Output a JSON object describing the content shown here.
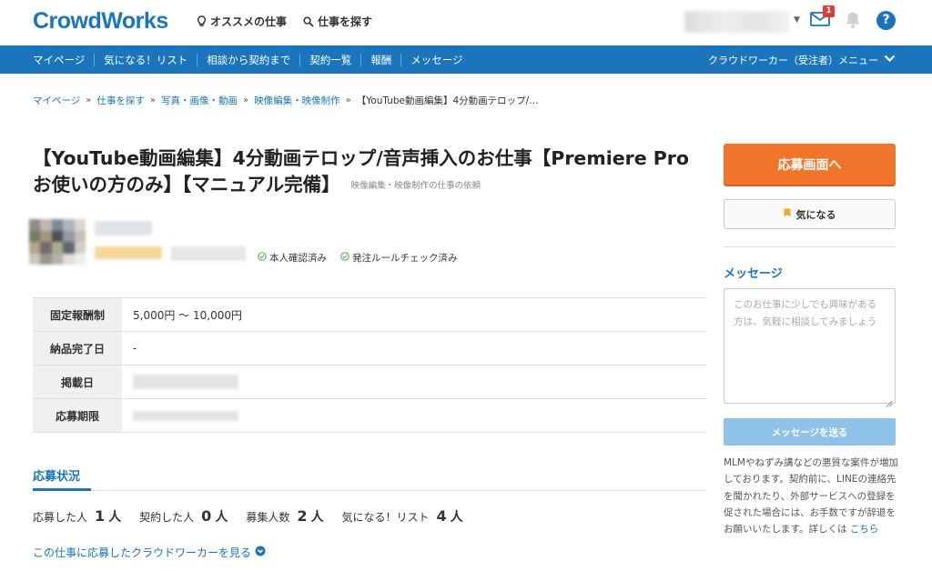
{
  "header": {
    "logo": "CrowdWorks",
    "recommended": "オススメの仕事",
    "search": "仕事を探す",
    "mail_badge": "1",
    "help": "?"
  },
  "nav": {
    "items": [
      "マイページ",
      "気になる！リスト",
      "相談から契約まで",
      "契約一覧",
      "報酬",
      "メッセージ"
    ],
    "menu": "クラウドワーカー（受注者）メニュー"
  },
  "breadcrumb": {
    "items": [
      "マイページ",
      "仕事を探す",
      "写真・画像・動画",
      "映像編集・映像制作"
    ],
    "current": "【YouTube動画編集】4分動画テロップ/…"
  },
  "job": {
    "title": "【YouTube動画編集】4分動画テロップ/音声挿入のお仕事【Premiere Proお使いの方のみ】【マニュアル完備】",
    "category": "映像編集・映像制作の仕事の依頼",
    "verified_identity": "本人確認済み",
    "verified_rules": "発注ルールチェック済み"
  },
  "details": {
    "rows": [
      {
        "label": "固定報酬制",
        "value": "5,000円 〜 10,000円"
      },
      {
        "label": "納品完了日",
        "value": "-"
      },
      {
        "label": "掲載日",
        "value": ""
      },
      {
        "label": "応募期限",
        "value": ""
      }
    ]
  },
  "status": {
    "heading": "応募状況",
    "stats": [
      {
        "label": "応募した人",
        "value": "1",
        "unit": "人"
      },
      {
        "label": "契約した人",
        "value": "0",
        "unit": "人"
      },
      {
        "label": "募集人数",
        "value": "2",
        "unit": "人"
      },
      {
        "label": "気になる！リスト",
        "value": "4",
        "unit": "人"
      }
    ],
    "see_link": "この仕事に応募したクラウドワーカーを見る"
  },
  "sidebar": {
    "apply": "応募画面へ",
    "favorite": "気になる",
    "message_heading": "メッセージ",
    "message_placeholder": "このお仕事に少しでも興味がある方は、気軽に相談してみましょう",
    "send": "メッセージを送る",
    "warning": "MLMやねずみ講などの悪質な案件が増加しております。契約前に、LINEの連絡先を聞かれたり、外部サービスへの登録を促された場合には、お手数ですが辞退をお願いいたします。詳しくは",
    "warning_link": "こちら"
  },
  "colors": {
    "brand_blue": "#1a75bc",
    "apply_orange": "#f0752a",
    "send_blue": "#8fc2e8",
    "badge_red": "#e53935",
    "favorite_ribbon": "#f0a830"
  }
}
